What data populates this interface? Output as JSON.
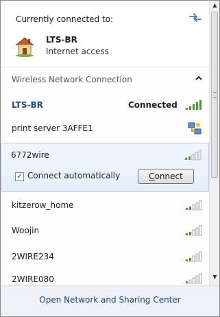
{
  "header": {
    "title": "Currently connected to:",
    "refresh_icon": "refresh-icon",
    "current": {
      "name": "LTS-BR",
      "status": "Internet access",
      "icon": "house-network-icon"
    }
  },
  "section": {
    "label": "Wireless Network Connection",
    "collapse_icon": "chevron-up-icon"
  },
  "networks": [
    {
      "name": "LTS-BR",
      "status": "Connected",
      "signal_bars": 5
    },
    {
      "name": "print server 3AFFE1",
      "icon": "adhoc-network-icon"
    },
    {
      "name": "6772wire",
      "signal_bars": 2,
      "auto_label": "Connect automatically",
      "auto_checked": true,
      "button_accel": "C",
      "button_rest": "onnect"
    },
    {
      "name": "kitzerow_home",
      "signal_bars": 2
    },
    {
      "name": "Woojin",
      "signal_bars": 2
    },
    {
      "name": "2WIRE234",
      "signal_bars": 2
    },
    {
      "name": "2WIRE080",
      "signal_bars": 1
    }
  ],
  "footer": {
    "link": "Open Network and Sharing Center"
  }
}
